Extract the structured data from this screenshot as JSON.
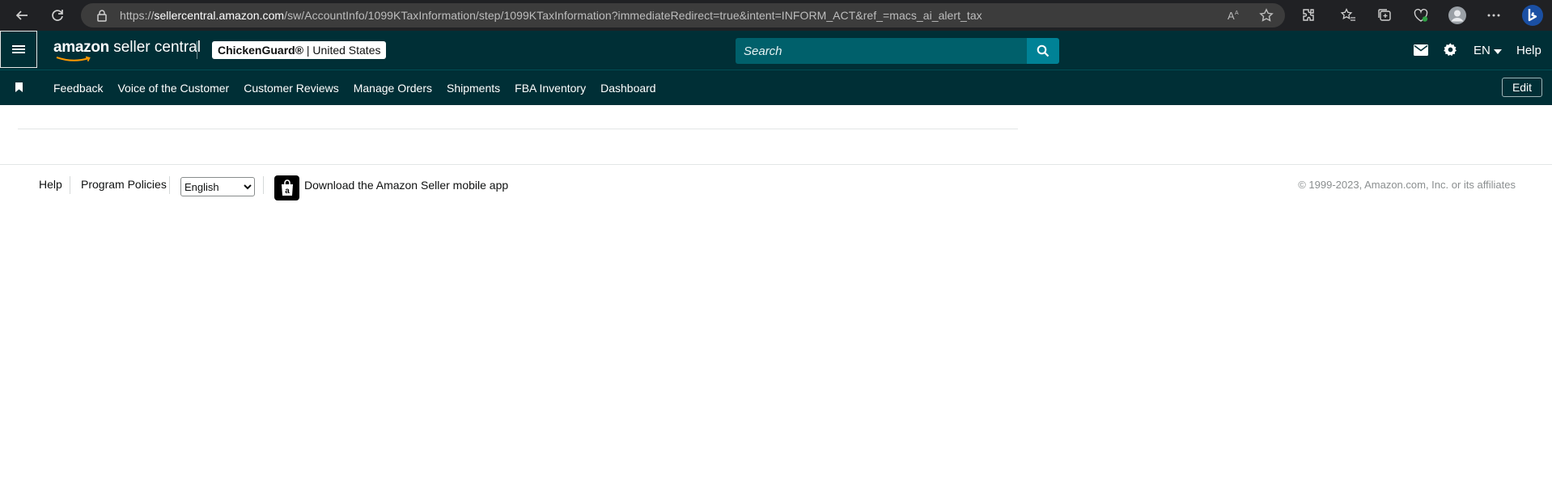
{
  "browser": {
    "url_prefix": "https://",
    "url_domain": "sellercentral.amazon.com",
    "url_path": "/sw/AccountInfo/1099KTaxInformation/step/1099KTaxInformation?immediateRedirect=true&intent=INFORM_ACT&ref_=macs_ai_alert_tax"
  },
  "header": {
    "logo_brand": "amazon",
    "logo_suffix": "seller central",
    "account_name": "ChickenGuard®",
    "account_region": "| United States",
    "search_placeholder": "Search",
    "language": "EN",
    "help_label": "Help"
  },
  "bookmarks": {
    "links": [
      "Feedback",
      "Voice of the Customer",
      "Customer Reviews",
      "Manage Orders",
      "Shipments",
      "FBA Inventory",
      "Dashboard"
    ],
    "edit_label": "Edit"
  },
  "footer": {
    "help_label": "Help",
    "policies_label": "Program Policies",
    "language_selected": "English",
    "app_link_label": "Download the Amazon Seller mobile app",
    "copyright": "© 1999-2023, Amazon.com, Inc. or its affiliates"
  },
  "colors": {
    "header_bg": "#002f36",
    "search_bg": "#00606b",
    "search_button_bg": "#008296",
    "browser_bg": "#202124"
  }
}
